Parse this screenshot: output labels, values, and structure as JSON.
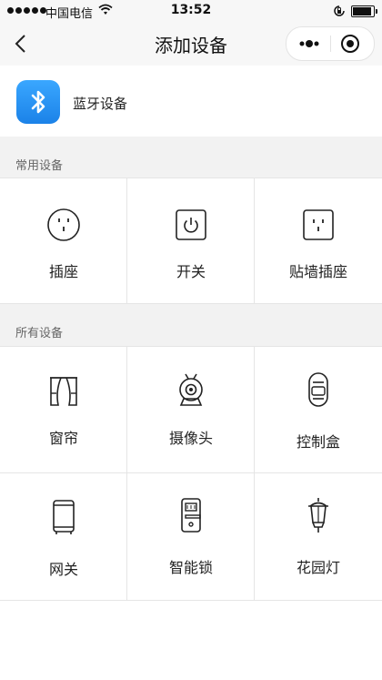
{
  "status_bar": {
    "carrier": "中国电信",
    "time": "13:52"
  },
  "nav": {
    "title": "添加设备"
  },
  "bluetooth": {
    "label": "蓝牙设备"
  },
  "common_section": {
    "header": "常用设备",
    "items": [
      {
        "label": "插座",
        "icon": "round-socket-icon"
      },
      {
        "label": "开关",
        "icon": "power-switch-icon"
      },
      {
        "label": "贴墙插座",
        "icon": "wall-socket-icon"
      }
    ]
  },
  "all_section": {
    "header": "所有设备",
    "items": [
      {
        "label": "窗帘",
        "icon": "curtain-icon"
      },
      {
        "label": "摄像头",
        "icon": "camera-icon"
      },
      {
        "label": "控制盒",
        "icon": "control-box-icon"
      },
      {
        "label": "网关",
        "icon": "gateway-icon"
      },
      {
        "label": "智能锁",
        "icon": "smart-lock-icon"
      },
      {
        "label": "花园灯",
        "icon": "garden-lamp-icon"
      }
    ]
  },
  "colors": {
    "accent_blue": "#1b82e8",
    "section_bg": "#f2f2f2",
    "navbar_bg": "#f7f7f7"
  }
}
